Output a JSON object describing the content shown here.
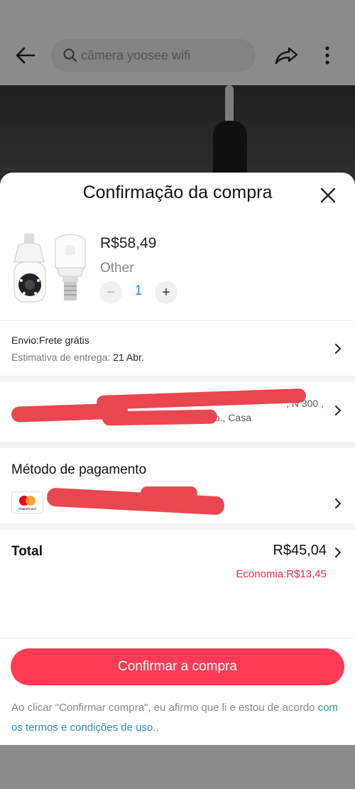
{
  "background": {
    "search": {
      "placeholder": "câmera yoosee wifi"
    }
  },
  "sheet": {
    "title": "Confirmação da compra",
    "product": {
      "price": "R$58,49",
      "variant": "Other",
      "quantity": "1",
      "minus": "−",
      "plus": "+"
    },
    "shipping": {
      "title": "Envio:Frete grátis",
      "estimate_label": "Estimativa de entrega:",
      "estimate_date": "21 Abr."
    },
    "address": {
      "line1": ", N 300 ,",
      "line2": "o., Casa"
    },
    "payment": {
      "title": "Método de pagamento",
      "card_brand": "mastercard"
    },
    "total": {
      "label": "Total",
      "value": "R$45,04",
      "saving": "Economia:R$13,45"
    },
    "footer": {
      "confirm_label": "Confirmar a compra",
      "terms_text": "Ao clicar \"Confirmar compra\", eu afirmo que li e estou de acordo ",
      "terms_link": "com os termos e condições de uso.."
    }
  },
  "colors": {
    "accent": "#ff3b55",
    "link": "#2a8fb5",
    "saving": "#e02b3a",
    "redaction": "#e8474f"
  }
}
